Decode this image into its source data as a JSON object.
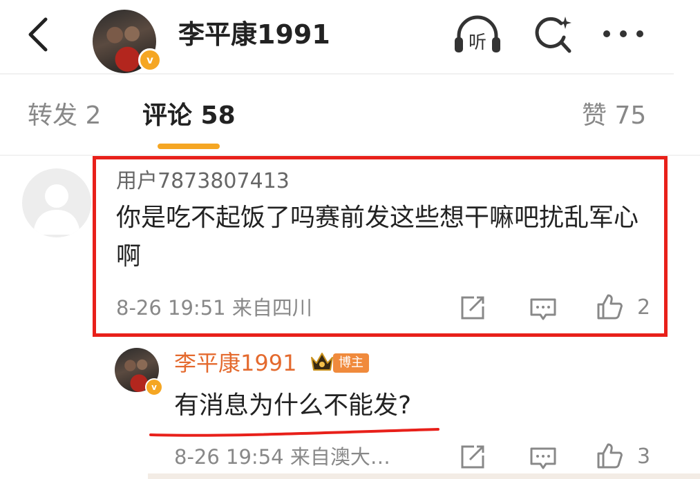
{
  "header": {
    "title": "李平康1991",
    "verified_mark": "v",
    "icons": [
      "back-icon",
      "listen-icon",
      "search-icon",
      "more-icon"
    ],
    "listen_label": "听"
  },
  "tabs": {
    "repost": "转发 2",
    "comment": "评论 58",
    "like": "赞 75",
    "accent_color": "#f5a623"
  },
  "comments": [
    {
      "user": "用户7873807413",
      "text": "你是吃不起饭了吗赛前发这些想干嘛吧扰乱军心啊",
      "meta": "8-26 19:51  来自四川",
      "likes": "2",
      "highlight_color": "#e8201a"
    },
    {
      "user": "李平康1991",
      "author_badge": "博主",
      "text": "有消息为什么不能发?",
      "meta": "8-26 19:54  来自澳大…",
      "likes": "3",
      "name_color": "#e46a2e"
    }
  ]
}
